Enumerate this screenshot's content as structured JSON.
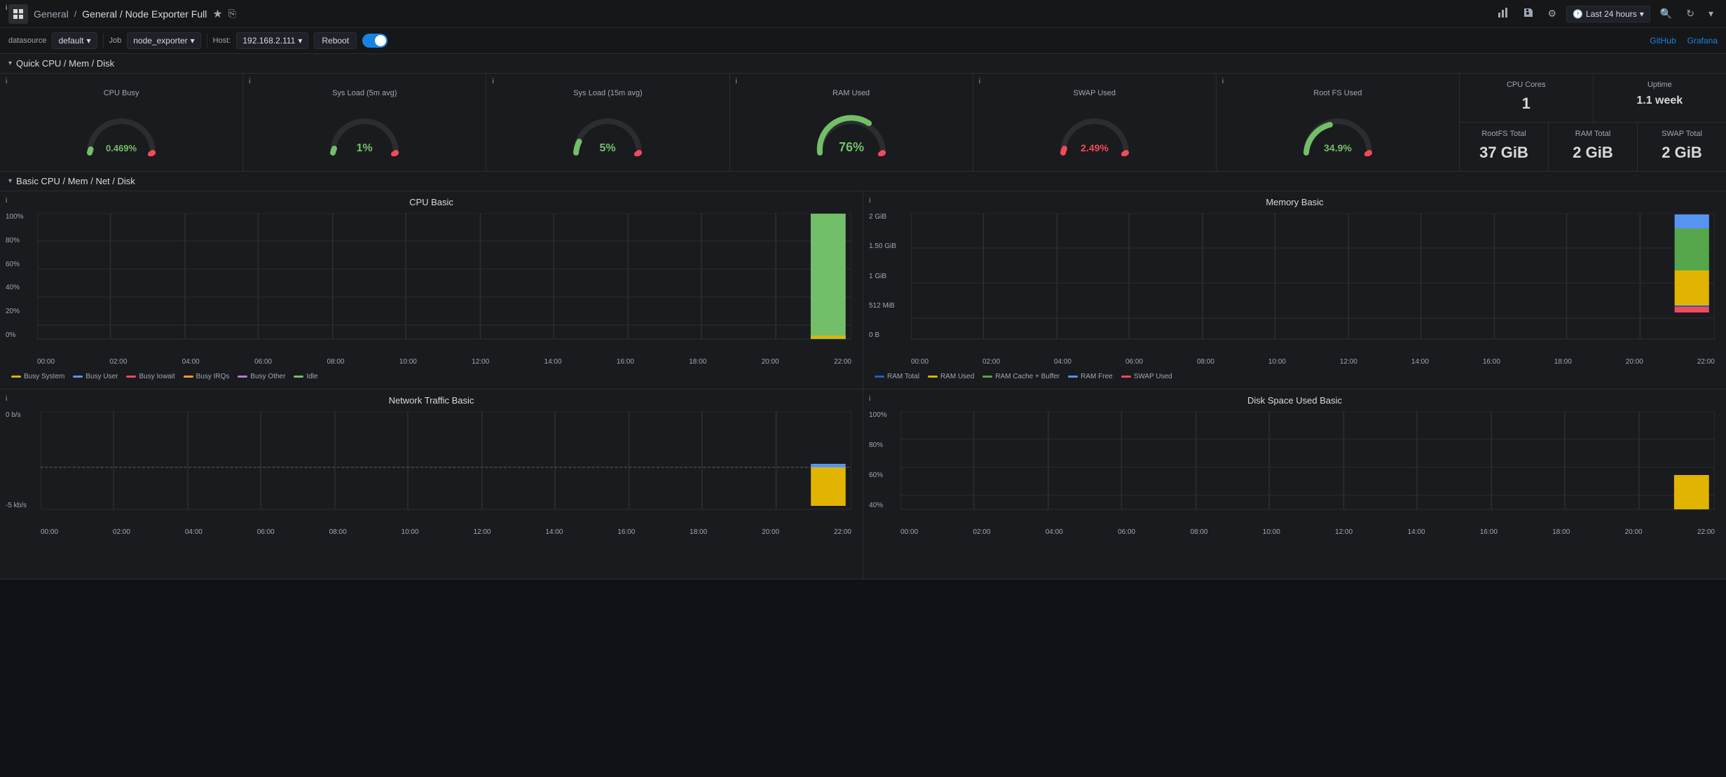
{
  "topbar": {
    "title": "General / Node Exporter Full",
    "star_icon": "★",
    "share_icon": "⎘",
    "time_range": "Last 24 hours",
    "search_icon": "🔍",
    "refresh_icon": "↻",
    "settings_icon": "⚙",
    "save_icon": "💾",
    "chart_icon": "📊"
  },
  "toolbar": {
    "datasource_label": "datasource",
    "datasource_value": "default",
    "job_label": "Job",
    "job_value": "node_exporter",
    "host_label": "Host:",
    "host_value": "192.168.2.111",
    "reboot_label": "Reboot",
    "github_label": "GitHub",
    "grafana_label": "Grafana"
  },
  "sections": {
    "quick_section": "Quick CPU / Mem / Disk",
    "basic_section": "Basic CPU / Mem / Net / Disk"
  },
  "gauges": [
    {
      "title": "CPU Busy",
      "value": "0.469%",
      "color": "green",
      "pct": 0.469
    },
    {
      "title": "Sys Load (5m avg)",
      "value": "1%",
      "color": "green",
      "pct": 1
    },
    {
      "title": "Sys Load (15m avg)",
      "value": "5%",
      "color": "green",
      "pct": 5
    },
    {
      "title": "RAM Used",
      "value": "76%",
      "color": "green",
      "pct": 76
    },
    {
      "title": "SWAP Used",
      "value": "2.49%",
      "color": "red",
      "pct": 2.49
    },
    {
      "title": "Root FS Used",
      "value": "34.9%",
      "color": "green",
      "pct": 34.9
    }
  ],
  "mini_stats": {
    "cpu_cores": {
      "title": "CPU Cores",
      "value": "1"
    },
    "uptime": {
      "title": "Uptime",
      "value": "1.1 week"
    },
    "rootfs_total": {
      "title": "RootFS Total",
      "value": "37 GiB"
    },
    "ram_total": {
      "title": "RAM Total",
      "value": "2 GiB"
    },
    "swap_total": {
      "title": "SWAP Total",
      "value": "2 GiB"
    }
  },
  "cpu_chart": {
    "title": "CPU Basic",
    "y_labels": [
      "100%",
      "80%",
      "60%",
      "40%",
      "20%",
      "0%"
    ],
    "x_labels": [
      "00:00",
      "02:00",
      "04:00",
      "06:00",
      "08:00",
      "10:00",
      "12:00",
      "14:00",
      "16:00",
      "18:00",
      "20:00",
      "22:00"
    ],
    "legend": [
      {
        "label": "Busy System",
        "color": "#e0b400"
      },
      {
        "label": "Busy User",
        "color": "#5794f2"
      },
      {
        "label": "Busy Iowait",
        "color": "#f2495c"
      },
      {
        "label": "Busy IRQs",
        "color": "#ff9830"
      },
      {
        "label": "Busy Other",
        "color": "#b877d9"
      },
      {
        "label": "Idle",
        "color": "#73bf69"
      }
    ]
  },
  "memory_chart": {
    "title": "Memory Basic",
    "y_labels": [
      "2 GiB",
      "1.50 GiB",
      "1 GiB",
      "512 MiB",
      "0 B"
    ],
    "x_labels": [
      "00:00",
      "02:00",
      "04:00",
      "06:00",
      "08:00",
      "10:00",
      "12:00",
      "14:00",
      "16:00",
      "18:00",
      "20:00",
      "22:00"
    ],
    "legend": [
      {
        "label": "RAM Total",
        "color": "#1f60c4"
      },
      {
        "label": "RAM Used",
        "color": "#e0b400"
      },
      {
        "label": "RAM Cache + Buffer",
        "color": "#56a64b"
      },
      {
        "label": "RAM Free",
        "color": "#5794f2"
      },
      {
        "label": "SWAP Used",
        "color": "#f2495c"
      }
    ]
  },
  "network_chart": {
    "title": "Network Traffic Basic",
    "y_labels": [
      "0 b/s",
      "-5 kb/s"
    ],
    "x_labels": [
      "00:00",
      "02:00",
      "04:00",
      "06:00",
      "08:00",
      "10:00",
      "12:00",
      "14:00",
      "16:00",
      "18:00",
      "20:00",
      "22:00"
    ]
  },
  "disk_chart": {
    "title": "Disk Space Used Basic",
    "y_labels": [
      "100%",
      "80%",
      "60%",
      "40%"
    ],
    "x_labels": [
      "00:00",
      "02:00",
      "04:00",
      "06:00",
      "08:00",
      "10:00",
      "12:00",
      "14:00",
      "16:00",
      "18:00",
      "20:00",
      "22:00"
    ]
  }
}
